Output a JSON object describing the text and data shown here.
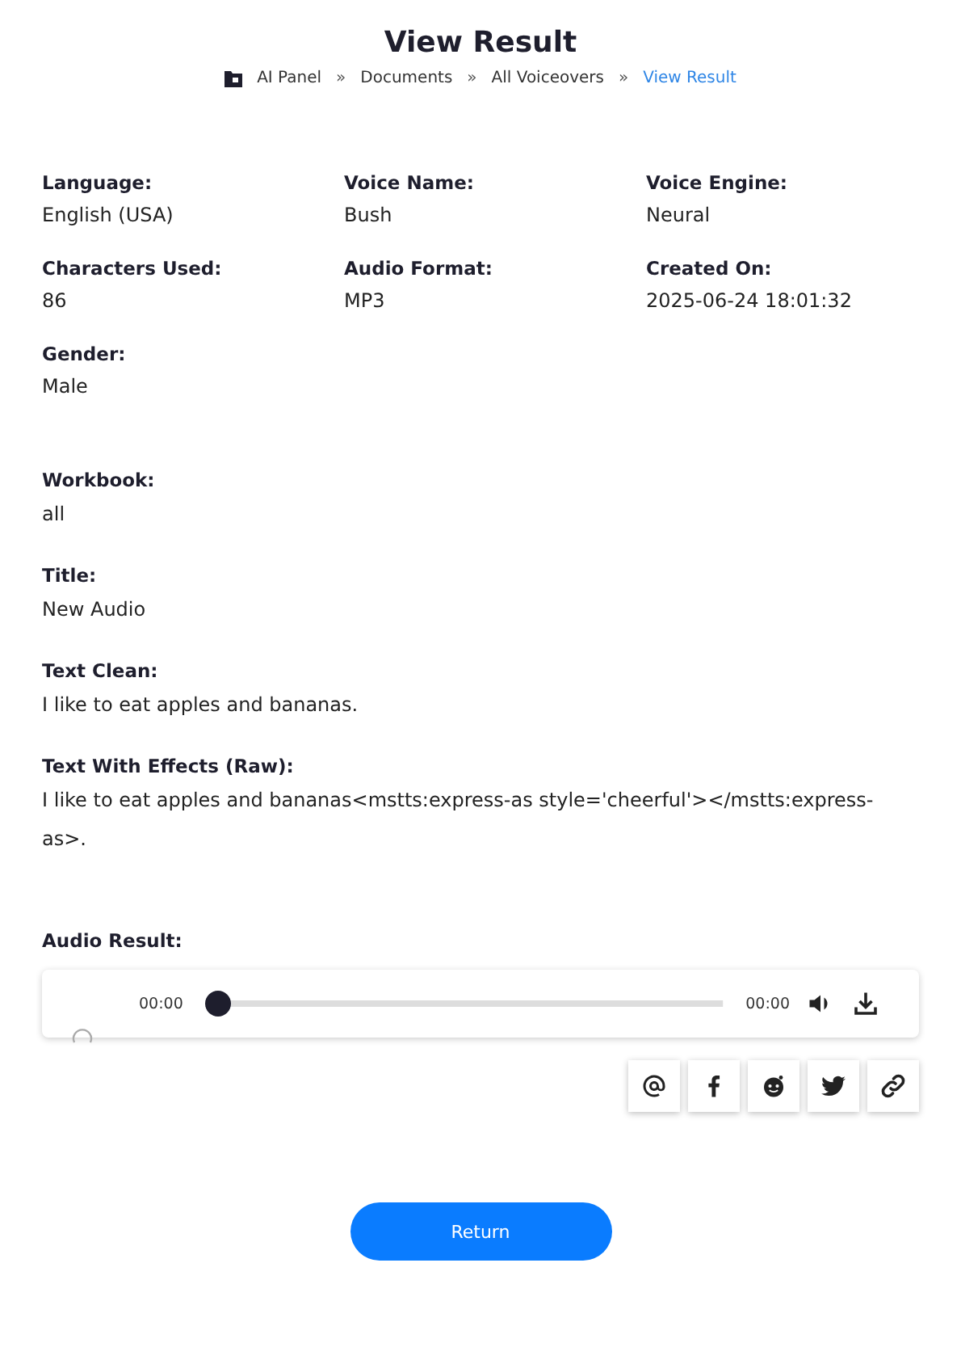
{
  "title": "View Result",
  "breadcrumb": [
    {
      "label": "AI Panel",
      "selected": false
    },
    {
      "label": "Documents",
      "selected": false
    },
    {
      "label": "All Voiceovers",
      "selected": false
    },
    {
      "label": "View Result",
      "selected": true
    }
  ],
  "breadcrumb_separator": "»",
  "details": [
    {
      "label": "Language:",
      "value": "English (USA)"
    },
    {
      "label": "Voice Name:",
      "value": "Bush"
    },
    {
      "label": "Voice Engine:",
      "value": "Neural"
    },
    {
      "label": "Characters Used:",
      "value": "86"
    },
    {
      "label": "Audio Format:",
      "value": "MP3"
    },
    {
      "label": "Created On:",
      "value": "2025-06-24 18:01:32"
    },
    {
      "label": "Gender:",
      "value": "Male"
    }
  ],
  "fields": [
    {
      "label": "Workbook:",
      "value": "all"
    },
    {
      "label": "Title:",
      "value": "New Audio"
    },
    {
      "label": "Text Clean:",
      "value": "I like to eat apples and bananas."
    },
    {
      "label": "Text With Effects (Raw):",
      "value": "I like to eat apples and bananas<mstts:express-as style='cheerful'></mstts:express-as>."
    }
  ],
  "audio": {
    "label": "Audio Result:",
    "current_time": "00:00",
    "duration": "00:00",
    "level": 0
  },
  "share_buttons": [
    {
      "kind": "email"
    },
    {
      "kind": "facebook"
    },
    {
      "kind": "reddit"
    },
    {
      "kind": "twitter"
    },
    {
      "kind": "link"
    }
  ],
  "return_button": "Return"
}
